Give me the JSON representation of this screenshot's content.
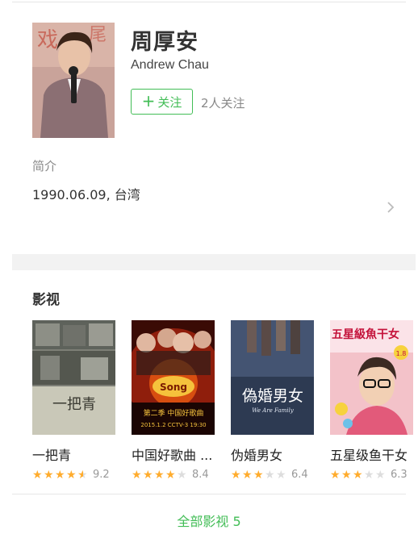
{
  "person": {
    "name": "周厚安",
    "en_name": "Andrew Chau",
    "follow_label": "关注",
    "followers": "2人关注"
  },
  "intro": {
    "label": "简介",
    "text": "1990.06.09, 台湾"
  },
  "works": {
    "title": "影视",
    "items": [
      {
        "title": "一把青",
        "rating": "9.2",
        "stars": 4.5,
        "poster_text": "一把青"
      },
      {
        "title": "中国好歌曲 ...",
        "rating": "8.4",
        "stars": 4,
        "poster_text": "第二季 中国好歌曲",
        "poster_sub": "2015.1.2 CCTV-3 19:30"
      },
      {
        "title": "伪婚男女",
        "rating": "6.4",
        "stars": 3,
        "poster_text": "偽婚男女",
        "poster_sub": "We Are Family"
      },
      {
        "title": "五星级鱼干女",
        "rating": "6.3",
        "stars": 3,
        "poster_text": "五星級魚干女",
        "poster_sub": "1.8"
      }
    ],
    "all_link": "全部影视 5"
  },
  "colors": {
    "accent": "#42bd56",
    "star": "#ffac2d"
  }
}
